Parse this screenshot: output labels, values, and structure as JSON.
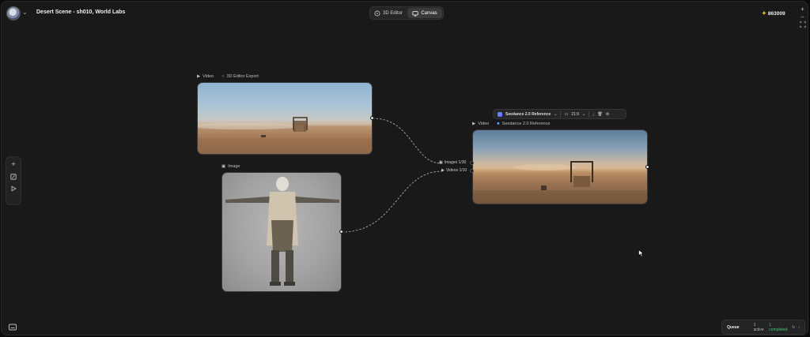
{
  "header": {
    "project_title": "Desert Scene - sh010, World Labs",
    "modes": [
      {
        "label": "3D Editor",
        "icon": "cube-icon",
        "active": false
      },
      {
        "label": "Canvas",
        "icon": "monitor-icon",
        "active": true
      }
    ],
    "credits": "863009",
    "zoom_in": "+",
    "zoom_out": "−"
  },
  "left_toolbar": {
    "add": "+",
    "tools": [
      "image-edit-icon",
      "play-icon"
    ]
  },
  "nodes": {
    "video_export": {
      "type_label": "Video",
      "name": "3D Editor Export"
    },
    "image": {
      "type_label": "Image"
    },
    "seedance": {
      "type_label": "Video",
      "name": "Seedance 2.0 Reference"
    }
  },
  "node_toolbar": {
    "model": "Seedance 2.0 Reference",
    "aspect": "21:9"
  },
  "connectors": {
    "images": "Images 1/30",
    "videos": "Videos 1/10"
  },
  "queue": {
    "title": "Queue",
    "active": "1 active",
    "completed": "1 completed"
  }
}
